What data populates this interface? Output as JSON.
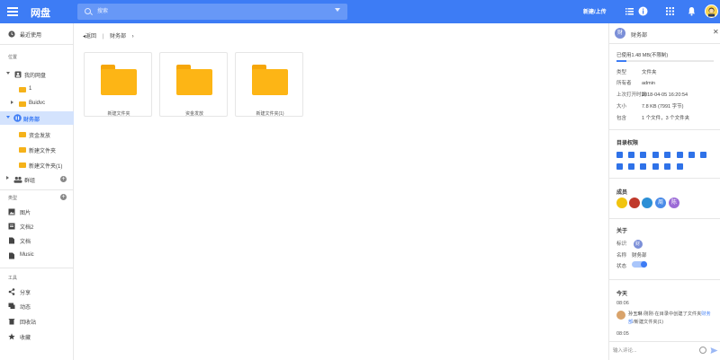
{
  "topbar": {
    "brand": "网盘",
    "search_placeholder": "搜索",
    "upload_label": "新建/上传",
    "accent": "#3d7cf5"
  },
  "sidebar": {
    "recent": "最近使用",
    "location_header": "位置",
    "my_drive": "我的网盘",
    "my_drive_children": [
      "1",
      "Buidvc"
    ],
    "team": "财务部",
    "team_children": [
      "资金发放",
      "新建文件夹",
      "新建文件夹(1)"
    ],
    "groups": "群组",
    "types_header": "类型",
    "types": [
      "图片",
      "文档2",
      "文档",
      "Music"
    ],
    "tools_header": "工具",
    "tools": [
      "分享",
      "动态",
      "回收站",
      "收藏"
    ]
  },
  "breadcrumb": {
    "back": "返回",
    "sep": "|",
    "current": "财务部"
  },
  "folders": [
    {
      "name": "新建文件夹"
    },
    {
      "name": "资金发放"
    },
    {
      "name": "新建文件夹(1)"
    }
  ],
  "panel": {
    "avatar_char": "财",
    "title": "财务部",
    "usage": "已使用1.48 MB(不限制)",
    "usage_fraction": 0.1,
    "props": [
      {
        "k": "类型",
        "v": "文件夹"
      },
      {
        "k": "所有者",
        "v": "admin"
      },
      {
        "k": "上次打开时间",
        "v": "2018-04-05 16:20:54"
      },
      {
        "k": "大小",
        "v": "7.8 KB (7991 字节)"
      },
      {
        "k": "包含",
        "v": "1 个文件，3 个文件夹"
      }
    ],
    "perm_title": "目录权限",
    "members_title": "成员",
    "members": [
      {
        "char": "",
        "color": "#f1c40f"
      },
      {
        "char": "",
        "color": "#c0392b"
      },
      {
        "char": "",
        "color": "#2c8fd6"
      },
      {
        "char": "周",
        "color": "#4a8be8"
      },
      {
        "char": "陈",
        "color": "#9b6bd6"
      }
    ],
    "about_title": "关于",
    "about": {
      "k1": "标识",
      "v1": "财",
      "k2": "名称",
      "v2": "财务部",
      "k3": "状态"
    },
    "today_title": "今天",
    "time1": "08:06",
    "activity_user": "孙玉琳",
    "activity_mid": "·刚刚·在目录中创建了文件夹",
    "activity_link": "财务部",
    "activity_tail": "/新建文件夹(1)",
    "time2": "08:05",
    "comment_placeholder": "输入评论..."
  }
}
